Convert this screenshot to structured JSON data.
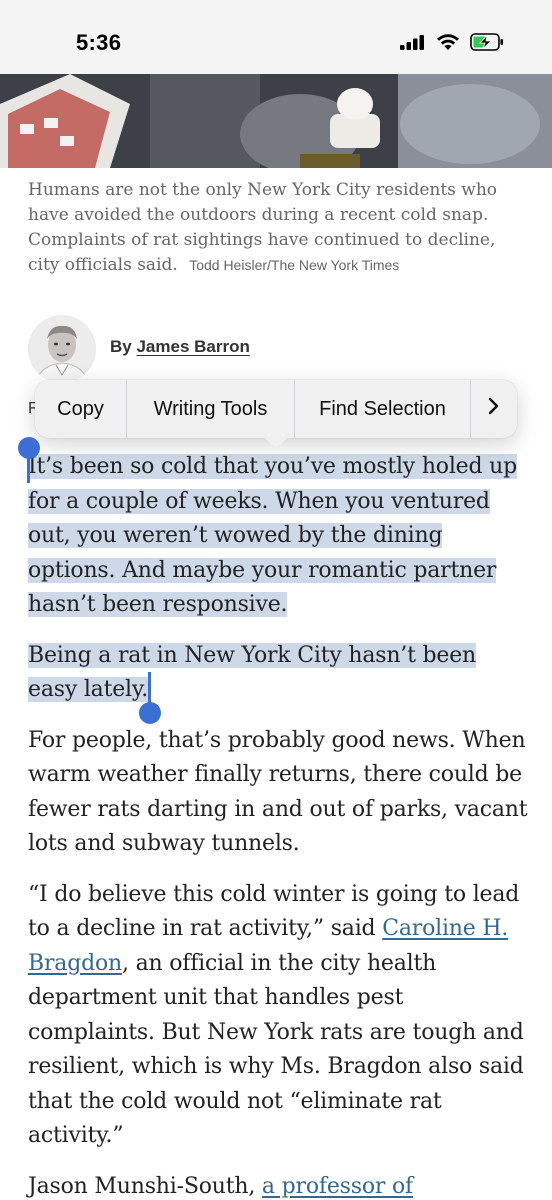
{
  "status_bar": {
    "time": "5:36",
    "icons": [
      "signal-icon",
      "wifi-icon",
      "battery-charging-icon"
    ]
  },
  "hero": {
    "description_icon": "photo"
  },
  "caption": {
    "text": "Humans are not the only New York City residents who have avoided the outdoors during a recent cold snap. Complaints of rat sightings have continued to decline, city officials said.",
    "credit": "Todd Heisler/The New York Times"
  },
  "byline": {
    "prefix": "By",
    "author": "James Barron"
  },
  "hidden_line_start": "F",
  "context_menu": {
    "items": [
      "Copy",
      "Writing Tools",
      "Find Selection"
    ],
    "more_glyph": "›"
  },
  "article": {
    "p1": "It’s been so cold that you’ve mostly holed up for a couple of weeks. When you ventured out, you weren’t wowed by the dining options. And maybe your romantic partner hasn’t been responsive.",
    "p2": "Being a rat in New York City hasn’t been easy lately.",
    "p3": "For people, that’s probably good news. When warm weather finally returns, there could be fewer rats darting in and out of parks, vacant lots and subway tunnels.",
    "p4_a": "“I do believe this cold winter is going to lead to a decline in rat activity,” said ",
    "p4_link": "Caroline H. Bragdon",
    "p4_b": ", an official in the city health department unit that handles pest complaints. But New York rats are tough and resilient, which is why Ms. Bragdon also said that the cold would not “eliminate rat activity.”",
    "p5_a": "Jason Munshi-South, ",
    "p5_link": "a professor of"
  },
  "colors": {
    "selection": "#cdd9e8",
    "handle": "#3b6fd4",
    "link": "#326891"
  }
}
